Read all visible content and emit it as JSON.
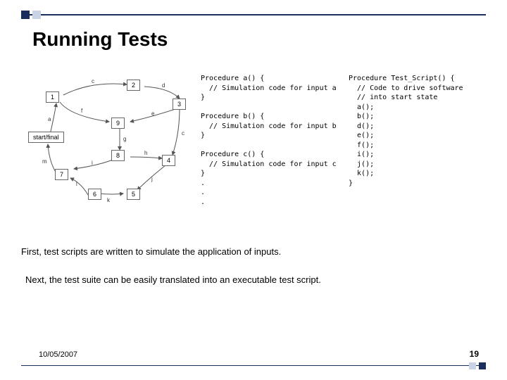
{
  "title": "Running Tests",
  "diagram": {
    "nodes": {
      "n1": "1",
      "n2": "2",
      "n3": "3",
      "n4": "4",
      "n5": "5",
      "n6": "6",
      "n7": "7",
      "n8": "8",
      "n9": "9",
      "start": "start/final"
    },
    "edge_labels": {
      "e_c": "c",
      "e_d": "d",
      "e_f": "f",
      "e_e": "e",
      "e_g": "g",
      "e_c2": "c",
      "e_a": "a",
      "e_m": "m",
      "e_l": "l",
      "e_k": "k",
      "e_h": "h",
      "e_i": "i",
      "e_j": "j"
    }
  },
  "code_procedures": "Procedure a() {\n  // Simulation code for input a\n}\n\nProcedure b() {\n  // Simulation code for input b\n}\n\nProcedure c() {\n  // Simulation code for input c\n}\n.\n.\n.",
  "code_script": "Procedure Test_Script() {\n  // Code to drive software\n  // into start state\n  a();\n  b();\n  d();\n  e();\n  f();\n  i();\n  j();\n  k();\n}",
  "para1": "First, test scripts are written to simulate the application of inputs.",
  "para2": "Next, the test suite can be easily translated into an executable test script.",
  "footer": {
    "date": "10/05/2007",
    "page": "19"
  }
}
